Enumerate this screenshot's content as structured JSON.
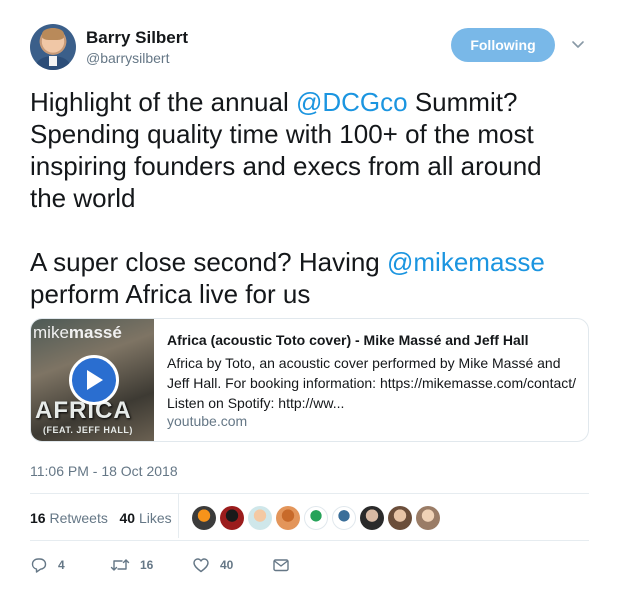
{
  "header": {
    "name": "Barry Silbert",
    "handle": "@barrysilbert",
    "follow_label": "Following"
  },
  "tweet": {
    "lines": [
      [
        {
          "text": "Highlight of the annual "
        },
        {
          "text": "@DCGco",
          "mention": true
        },
        {
          "text": " Summit?"
        }
      ],
      [
        {
          "text": "Spending quality time with 100+ of the most"
        }
      ],
      [
        {
          "text": "inspiring founders and execs from all around"
        }
      ],
      [
        {
          "text": "the world"
        }
      ],
      [],
      [
        {
          "text": "A super close second? Having "
        },
        {
          "text": "@mikemasse",
          "mention": true
        }
      ],
      [
        {
          "text": "perform Africa live for us"
        }
      ]
    ]
  },
  "card": {
    "thumb_text_top_a": "mike",
    "thumb_text_top_b": "massé",
    "thumb_text_main": "AFRICA",
    "thumb_text_sub": "(FEAT. JEFF HALL)",
    "title": "Africa (acoustic Toto cover) - Mike Massé and Jeff Hall",
    "description": "Africa by Toto, an acoustic cover performed by Mike Massé and Jeff Hall. For booking information: https://mikemasse.com/contact/ Listen on Spotify: http://ww...",
    "domain": "youtube.com"
  },
  "timestamp": "11:06 PM - 18 Oct 2018",
  "stats": {
    "retweets_count": "16",
    "retweets_label": "Retweets",
    "likes_count": "40",
    "likes_label": "Likes"
  },
  "liker_avatars": [
    {
      "icon": "bitcoin-avatar",
      "color": "#3b3b3b",
      "accent": "#f7931a"
    },
    {
      "icon": "red-dark-avatar",
      "color": "#9b1c1c",
      "accent": "#1a1a1a"
    },
    {
      "icon": "cartoon-girl-avatar",
      "color": "#cfe7ea",
      "accent": "#f4c9a3"
    },
    {
      "icon": "orange-emblem-avatar",
      "color": "#e3955a",
      "accent": "#c86a2a"
    },
    {
      "icon": "green-star-avatar",
      "color": "#ffffff",
      "accent": "#27a35a"
    },
    {
      "icon": "line-logo-avatar",
      "color": "#ffffff",
      "accent": "#3a6e99"
    },
    {
      "icon": "dark-woman-avatar",
      "color": "#2a2a2a",
      "accent": "#d8b9a3"
    },
    {
      "icon": "man-brown-avatar",
      "color": "#6b4e3a",
      "accent": "#e7c4a6"
    },
    {
      "icon": "man-photo-avatar",
      "color": "#9a7c66",
      "accent": "#f0d2b6"
    }
  ],
  "actions": {
    "reply_count": "4",
    "retweet_count": "16",
    "like_count": "40"
  },
  "colors": {
    "link": "#1b95e0",
    "follow_bg": "#79b8e8",
    "muted": "#657786"
  }
}
